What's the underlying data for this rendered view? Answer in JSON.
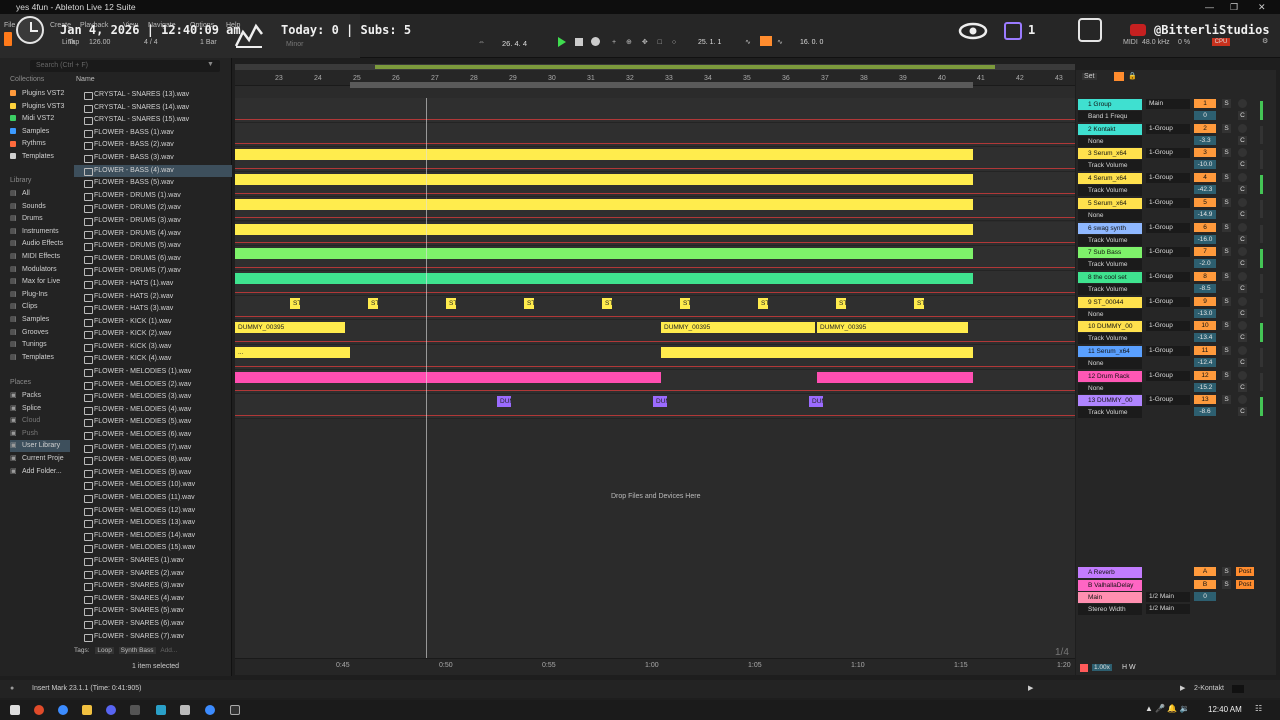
{
  "window": {
    "title": "yes 4fun - Ableton Live 12 Suite"
  },
  "menu": [
    "File",
    "Create",
    "Playback",
    "View",
    "Navigate",
    "Options",
    "Help"
  ],
  "overlay": {
    "date_time": "Jan 4, 2026 | 12:40:09 am",
    "today": "Today: 0 | Subs: 5",
    "count": "1",
    "handle": "@BitterliStudios"
  },
  "transport": {
    "tempo": "126.00",
    "signature": "4 / 4",
    "quantize": "1 Bar",
    "link": "Link",
    "tap": "Tap",
    "position": "26. 4. 4",
    "loop_start": "25. 1. 1",
    "loop_length": "16. 0. 0",
    "midi_label": "MIDI",
    "sample_rate": "48.0 kHz",
    "cpu": "CPU",
    "key": "Minor",
    "load": "0 %"
  },
  "browser": {
    "search_placeholder": "Search (Ctrl + F)",
    "collections_label": "Collections",
    "collections": [
      {
        "label": "Plugins VST2",
        "color": "#ff9a3c"
      },
      {
        "label": "Plugins VST3",
        "color": "#ffd23c"
      },
      {
        "label": "Midi VST2",
        "color": "#3ccf64"
      },
      {
        "label": "Samples",
        "color": "#3c9aff"
      },
      {
        "label": "Rythms",
        "color": "#ff6a3c"
      },
      {
        "label": "Templates",
        "color": "#d0d0d0"
      }
    ],
    "library_label": "Library",
    "library": [
      "All",
      "Sounds",
      "Drums",
      "Instruments",
      "Audio Effects",
      "MIDI Effects",
      "Modulators",
      "Max for Live",
      "Plug-Ins",
      "Clips",
      "Samples",
      "Grooves",
      "Tunings",
      "Templates"
    ],
    "places_label": "Places",
    "places": [
      "Packs",
      "Splice",
      "Cloud",
      "Push",
      "User Library",
      "Current Proje",
      "Add Folder..."
    ],
    "name_header": "Name",
    "files": [
      "CRYSTAL - SNARES (13).wav",
      "CRYSTAL - SNARES (14).wav",
      "CRYSTAL - SNARES (15).wav",
      "FLOWER - BASS (1).wav",
      "FLOWER - BASS (2).wav",
      "FLOWER - BASS (3).wav",
      "FLOWER - BASS (4).wav",
      "FLOWER - BASS (5).wav",
      "FLOWER - DRUMS (1).wav",
      "FLOWER - DRUMS (2).wav",
      "FLOWER - DRUMS (3).wav",
      "FLOWER - DRUMS (4).wav",
      "FLOWER - DRUMS (5).wav",
      "FLOWER - DRUMS (6).wav",
      "FLOWER - DRUMS (7).wav",
      "FLOWER - HATS (1).wav",
      "FLOWER - HATS (2).wav",
      "FLOWER - HATS (3).wav",
      "FLOWER - KICK (1).wav",
      "FLOWER - KICK (2).wav",
      "FLOWER - KICK (3).wav",
      "FLOWER - KICK (4).wav",
      "FLOWER - MELODIES (1).wav",
      "FLOWER - MELODIES (2).wav",
      "FLOWER - MELODIES (3).wav",
      "FLOWER - MELODIES (4).wav",
      "FLOWER - MELODIES (5).wav",
      "FLOWER - MELODIES (6).wav",
      "FLOWER - MELODIES (7).wav",
      "FLOWER - MELODIES (8).wav",
      "FLOWER - MELODIES (9).wav",
      "FLOWER - MELODIES (10).wav",
      "FLOWER - MELODIES (11).wav",
      "FLOWER - MELODIES (12).wav",
      "FLOWER - MELODIES (13).wav",
      "FLOWER - MELODIES (14).wav",
      "FLOWER - MELODIES (15).wav",
      "FLOWER - SNARES (1).wav",
      "FLOWER - SNARES (2).wav",
      "FLOWER - SNARES (3).wav",
      "FLOWER - SNARES (4).wav",
      "FLOWER - SNARES (5).wav",
      "FLOWER - SNARES (6).wav",
      "FLOWER - SNARES (7).wav"
    ],
    "selected_file": "FLOWER - BASS (4).wav",
    "tags_label": "Tags:",
    "tags": [
      "Loop",
      "Synth Bass"
    ],
    "tag_add": "Add...",
    "selection_status": "1 item selected"
  },
  "arrangement": {
    "bars": [
      "23",
      "24",
      "25",
      "26",
      "27",
      "28",
      "29",
      "30",
      "31",
      "32",
      "33",
      "34",
      "35",
      "36",
      "37",
      "38",
      "39",
      "40",
      "41",
      "42",
      "43"
    ],
    "times": [
      "0:45",
      "0:50",
      "0:55",
      "1:00",
      "1:05",
      "1:10",
      "1:15",
      "1:20"
    ],
    "drop_hint": "Drop Files and Devices Here",
    "page_indicator": "1/4",
    "clip_dummy": "DUMMY_00395",
    "clip_st": "ST",
    "clip_dum": "DUM",
    "clip_dots": "..."
  },
  "mixer": {
    "set_label": "Set",
    "tracks": [
      {
        "name": "1 Group",
        "color": "#3fe0d0",
        "io": "Main",
        "num": "1",
        "vol": "0",
        "sub": "Band 1 Frequ"
      },
      {
        "name": "2 Kontakt",
        "color": "#3fe0d0",
        "io": "1-Group",
        "num": "2",
        "vol": "-3.3",
        "sub": "None"
      },
      {
        "name": "3 Serum_x64",
        "color": "#ffe14d",
        "io": "1-Group",
        "num": "3",
        "vol": "-10.0",
        "sub": "Track Volume"
      },
      {
        "name": "4 Serum_x64",
        "color": "#ffe14d",
        "io": "1-Group",
        "num": "4",
        "vol": "-42.3",
        "sub": "Track Volume"
      },
      {
        "name": "5 Serum_x64",
        "color": "#ffe14d",
        "io": "1-Group",
        "num": "5",
        "vol": "-14.9",
        "sub": "None"
      },
      {
        "name": "6 swag synth",
        "color": "#8fb8ff",
        "io": "1-Group",
        "num": "6",
        "vol": "-16.0",
        "sub": "Track Volume"
      },
      {
        "name": "7 Sub Bass",
        "color": "#7ef26a",
        "io": "1-Group",
        "num": "7",
        "vol": "-2.0",
        "sub": "Track Volume"
      },
      {
        "name": "8 the cool set",
        "color": "#3fe38f",
        "io": "1-Group",
        "num": "8",
        "vol": "-8.5",
        "sub": "Track Volume"
      },
      {
        "name": "9 ST_00044",
        "color": "#ffe14d",
        "io": "1-Group",
        "num": "9",
        "vol": "-13.0",
        "sub": "None"
      },
      {
        "name": "10 DUMMY_00",
        "color": "#ffe14d",
        "io": "1-Group",
        "num": "10",
        "vol": "-13.4",
        "sub": "Track Volume"
      },
      {
        "name": "11 Serum_x64",
        "color": "#5aa0ff",
        "io": "1-Group",
        "num": "11",
        "vol": "-12.4",
        "sub": "None"
      },
      {
        "name": "12 Drum Rack",
        "color": "#ff57b5",
        "io": "1-Group",
        "num": "12",
        "vol": "-15.2",
        "sub": "None"
      },
      {
        "name": "13 DUMMY_00",
        "color": "#b085ff",
        "io": "1-Group",
        "num": "13",
        "vol": "-8.6",
        "sub": "Track Volume"
      }
    ],
    "returns": [
      {
        "name": "A Reverb",
        "color": "#c27cff",
        "num": "A"
      },
      {
        "name": "B ValhallaDelay",
        "color": "#ff66c4",
        "num": "B"
      }
    ],
    "main": {
      "name": "Main",
      "color": "#ff8fb0",
      "io": "1/2 Main",
      "io2": "1/2 Main",
      "vol": "0",
      "sub": "Stereo Width"
    },
    "zoom": "1.00x",
    "solo_label": "S",
    "c_label": "C",
    "post_label": "Post",
    "inf": "-inf"
  },
  "status": {
    "message": "Insert Mark 23.1.1 (Time: 0:41:905)",
    "device": "2-Kontakt"
  },
  "taskbar": {
    "clock": "12:40 AM"
  }
}
